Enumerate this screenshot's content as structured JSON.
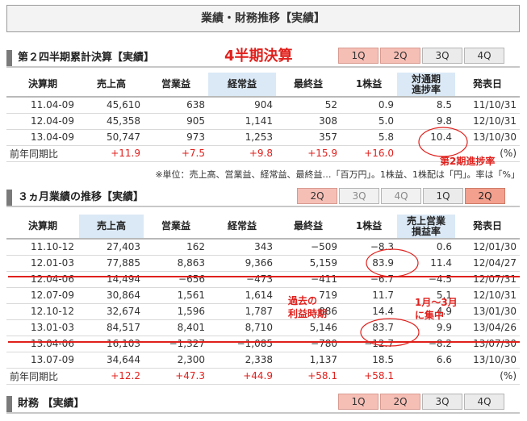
{
  "page_title": "業績・財務推移【実績】",
  "cumulative": {
    "title": "第２四半期累計決算【実績】",
    "accent": "4半期決算",
    "tabs": [
      {
        "label": "1Q",
        "style": "red"
      },
      {
        "label": "2Q",
        "style": "red"
      },
      {
        "label": "3Q",
        "style": "normal"
      },
      {
        "label": "4Q",
        "style": "normal"
      }
    ],
    "headers": [
      "決算期",
      "売上高",
      "営業益",
      "経常益",
      "最終益",
      "1株益",
      "対通期\n進捗率",
      "発表日"
    ],
    "rows": [
      [
        "11.04-09",
        "45,610",
        "638",
        "904",
        "52",
        "0.9",
        "8.5",
        "11/10/31"
      ],
      [
        "12.04-09",
        "45,358",
        "905",
        "1,141",
        "308",
        "5.0",
        "9.8",
        "12/10/31"
      ],
      [
        "13.04-09",
        "50,747",
        "973",
        "1,253",
        "357",
        "5.8",
        "10.4",
        "13/10/30"
      ]
    ],
    "yoy": {
      "label": "前年同期比",
      "values": [
        "+11.9",
        "+7.5",
        "+9.8",
        "+15.9",
        "+16.0"
      ],
      "unit": "(%)"
    },
    "note": "※単位：売上高、営業益、経常益、最終益…「百万円」。1株益、1株配は「円」。率は「%」"
  },
  "quarterly": {
    "title": "３ヵ月業績の推移【実績】",
    "tabs": [
      {
        "label": "2Q",
        "style": "red"
      },
      {
        "label": "3Q",
        "style": "grey"
      },
      {
        "label": "4Q",
        "style": "grey"
      },
      {
        "label": "1Q",
        "style": "normal"
      },
      {
        "label": "2Q",
        "style": "red-active"
      }
    ],
    "headers": [
      "決算期",
      "売上高",
      "営業益",
      "経常益",
      "最終益",
      "1株益",
      "売上営業\n損益率",
      "発表日"
    ],
    "rows": [
      [
        "11.10-12",
        "27,403",
        "162",
        "343",
        "−509",
        "−8.3",
        "0.6",
        "12/01/30"
      ],
      [
        "12.01-03",
        "77,885",
        "8,863",
        "9,366",
        "5,159",
        "83.9",
        "11.4",
        "12/04/27"
      ],
      [
        "12.04-06",
        "14,494",
        "−656",
        "−473",
        "−411",
        "−6.7",
        "−4.5",
        "12/07/31"
      ],
      [
        "12.07-09",
        "30,864",
        "1,561",
        "1,614",
        "719",
        "11.7",
        "5.1",
        "12/10/31"
      ],
      [
        "12.10-12",
        "32,674",
        "1,596",
        "1,787",
        "886",
        "14.4",
        "4.9",
        "13/01/30"
      ],
      [
        "13.01-03",
        "84,517",
        "8,401",
        "8,710",
        "5,146",
        "83.7",
        "9.9",
        "13/04/26"
      ],
      [
        "13.04-06",
        "16,103",
        "−1,327",
        "−1,085",
        "−780",
        "−12.7",
        "−8.2",
        "13/07/30"
      ],
      [
        "13.07-09",
        "34,644",
        "2,300",
        "2,338",
        "1,137",
        "18.5",
        "6.6",
        "13/10/30"
      ]
    ],
    "yoy": {
      "label": "前年同期比",
      "values": [
        "+12.2",
        "+47.3",
        "+44.9",
        "+58.1",
        "+58.1"
      ],
      "unit": "(%)"
    }
  },
  "finance": {
    "title": "財務 【実績】",
    "tabs": [
      {
        "label": "1Q",
        "style": "red"
      },
      {
        "label": "2Q",
        "style": "red"
      },
      {
        "label": "3Q",
        "style": "normal"
      },
      {
        "label": "4Q",
        "style": "normal"
      }
    ]
  },
  "annotations": {
    "progress_rate": "第2期進捗率",
    "profit_period_1": "過去の",
    "profit_period_2": "利益時期",
    "concentration_1": "1月～3月",
    "concentration_2": "に集中"
  },
  "colors": {
    "accent_red": "#e0201c",
    "tab_red": "#f6bfb6",
    "header_blue": "#dbe9f6"
  }
}
